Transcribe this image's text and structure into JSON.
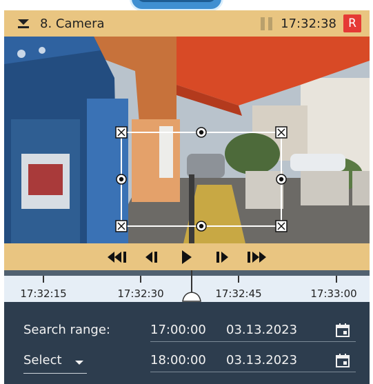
{
  "camera": {
    "title": "8. Camera",
    "time": "17:32:38",
    "recording_badge": "R"
  },
  "playback": {
    "buttons": [
      "skip-to-start-icon",
      "step-back-icon",
      "play-icon",
      "step-forward-icon",
      "skip-to-end-icon"
    ]
  },
  "timeline": {
    "ticks": [
      "17:32:15",
      "17:32:30",
      "17:32:45",
      "17:33:00"
    ]
  },
  "search": {
    "range_label": "Search range:",
    "start_time": "17:00:00",
    "start_date": "03.13.2023",
    "select_label": "Select",
    "end_time": "18:00:00",
    "end_date": "03.13.2023"
  },
  "colors": {
    "header_bg": "#e9c581",
    "record_red": "#e53935",
    "panel_bg": "#2d3d4e"
  }
}
